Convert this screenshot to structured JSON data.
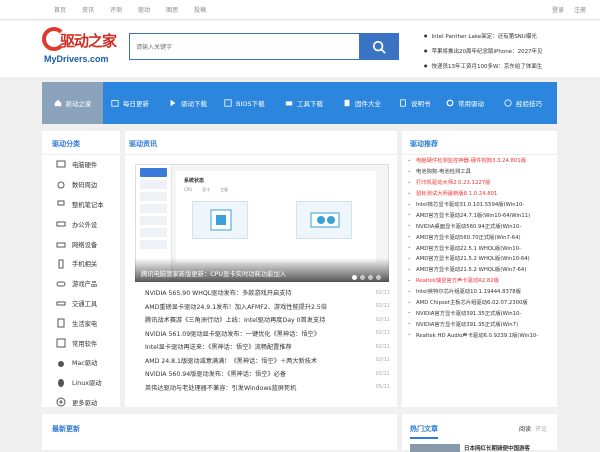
{
  "topbar": {
    "links": [
      "首页",
      "资讯",
      "评测",
      "驱动",
      "图思",
      "投稿"
    ],
    "login": "登录",
    "register": "注册"
  },
  "logo": {
    "cn": "驱动之家",
    "en": "MyDrivers.com"
  },
  "search": {
    "placeholder": "请输入关键字"
  },
  "headlines": [
    "Intel Panther Lake架定：还有第SNU曝光",
    "苹果将推出20周年纪念版iPhone：2027年见",
    "快递员13年工资月100多W：京东给了体面生"
  ],
  "nav": {
    "items": [
      "驱动之家",
      "每日更新",
      "驱动下载",
      "BIOS下载",
      "工具下载",
      "固件大全",
      "说明书",
      "常用驱动",
      "经验技巧"
    ]
  },
  "sidebar": {
    "title": "驱动分类",
    "items": [
      "电脑硬件",
      "数码周边",
      "整机笔记本",
      "办公外设",
      "网络设备",
      "手机相关",
      "游戏产品",
      "交通工具",
      "生活家电",
      "常用软件",
      "Mac驱动",
      "Linux驱动",
      "更多驱动"
    ]
  },
  "main": {
    "title": "驱动资讯",
    "slide_ui": {
      "title": "系统状态",
      "tabs": [
        "CPU",
        "显卡",
        "主板"
      ]
    },
    "caption": "腾讯电脑管家新版更新：CPU显卡实时功耗功能加入",
    "articles": [
      {
        "t": "NVIDIA 565.90 WHQL驱动发布：多款游戏开启支持",
        "d": "02/11"
      },
      {
        "t": "AMD重磅显卡驱动24.9.1发布！加入AFMF2、游戏性能提升2.5倍",
        "d": "02/11"
      },
      {
        "t": "腾讯战术赛游《三角洲行动》上线：Intel驱动再度Day 0首发支持",
        "d": "02/11"
      },
      {
        "t": "NVIDIA 561.09驱动显卡驱动发布：一键优化《黑神话：悟空》",
        "d": "02/11"
      },
      {
        "t": "Intel显卡驱动再送来：《黑神话：悟空》流畅配置推荐",
        "d": "02/11"
      },
      {
        "t": "AMD 24.8.1版驱动减意满满！《黑神话：悟空》＋两大新技术",
        "d": "02/11"
      },
      {
        "t": "NVIDIA 560.94版驱动发布：《黑神话：悟空》必备",
        "d": "02/11"
      },
      {
        "t": "英伟达驱动与老处理器不兼容：引发Windows蓝屏死机",
        "d": "05/11"
      }
    ]
  },
  "right": {
    "title": "驱动推荐",
    "items": [
      {
        "t": "电脑硬件检测监控神器-硬件狗狗3.3.24.801版",
        "red": true
      },
      {
        "t": "电池狗狗-电池检测工具",
        "red": false
      },
      {
        "t": "打印机驱动大师2.0.23.1227版",
        "red": true
      },
      {
        "t": "鼠标测试大师最新版8.1.0.24.801",
        "red": true
      },
      {
        "t": "Intel核芯显卡驱动31.0.101.5594版(Win10-",
        "red": false
      },
      {
        "t": "AMD官方显卡驱动24.7.1版(Win10-64/Win11)",
        "red": false
      },
      {
        "t": "NVIDIA桌面显卡驱动560.94正式版(Win10-",
        "red": false
      },
      {
        "t": "AMD官方显卡驱动560.70正式版(Win7-64)",
        "red": false
      },
      {
        "t": "AMD官方显卡驱动22.5.1 WHQL版(Win10-",
        "red": false
      },
      {
        "t": "AMD官方显卡驱动21.5.2 WHQL版(Win10-64)",
        "red": false
      },
      {
        "t": "AMD官方显卡驱动21.5.2 WHQL版(Win7-64)",
        "red": false
      },
      {
        "t": "Realtek瑞昱官方声卡驱动R2.82版",
        "red": true
      },
      {
        "t": "Intel英特尔芯片组驱动10.1.19444.8378版",
        "red": false
      },
      {
        "t": "AMD Chipset主板芯片组驱动6.02.07.2300版",
        "red": false
      },
      {
        "t": "NVIDIA官方显卡驱动391.35正式版(Win10-",
        "red": false
      },
      {
        "t": "NVIDIA官方显卡驱动391.35正式版(Win7)",
        "red": false
      },
      {
        "t": "Realtek HD Audio声卡驱动6.0.9239.1版(Win10-",
        "red": false
      }
    ]
  },
  "bottom": {
    "left_title": "最新更新",
    "right_title": "热门文章",
    "tab_read": "阅读",
    "tab_comment": "评论",
    "teaser": "日本网红长期骑便中国游客"
  }
}
